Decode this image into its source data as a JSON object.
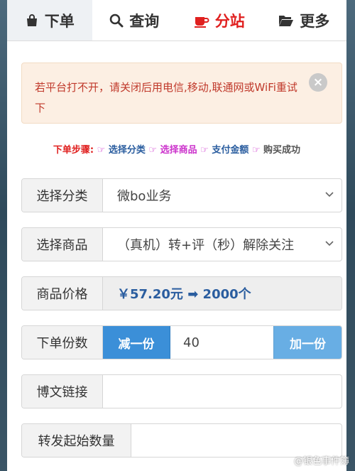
{
  "tabs": [
    {
      "label": "下单",
      "icon": "shopping-bag-icon"
    },
    {
      "label": "查询",
      "icon": "search-icon"
    },
    {
      "label": "分站",
      "icon": "coffee-cup-icon"
    },
    {
      "label": "更多",
      "icon": "folder-open-icon"
    }
  ],
  "alert": {
    "text": "若平台打不开，请关闭后用电信,移动,联通网或WiFi重试下",
    "close": "×"
  },
  "steps": {
    "prefix": "下单步骤:",
    "hand": "☞",
    "step1": "选择分类",
    "step2": "选择商品",
    "step3": "支付金额",
    "step4": "购买成功"
  },
  "form": {
    "category": {
      "label": "选择分类",
      "value": "微bo业务"
    },
    "product": {
      "label": "选择商品",
      "value": "（真机）转+评（秒）解除关注"
    },
    "price": {
      "label": "商品价格",
      "value": "￥57.20元 ➡ 2000个"
    },
    "quantity": {
      "label": "下单份数",
      "minus": "减一份",
      "value": "40",
      "plus": "加一份"
    },
    "link": {
      "label": "博文链接",
      "value": ""
    },
    "start_count": {
      "label": "转发起始数量",
      "value": ""
    }
  },
  "watermark": "@银色事件簿",
  "colors": {
    "accent_red": "#e0201f",
    "primary_blue": "#3b8fd8",
    "light_blue": "#68aee4",
    "alert_bg": "#fcefe3"
  }
}
